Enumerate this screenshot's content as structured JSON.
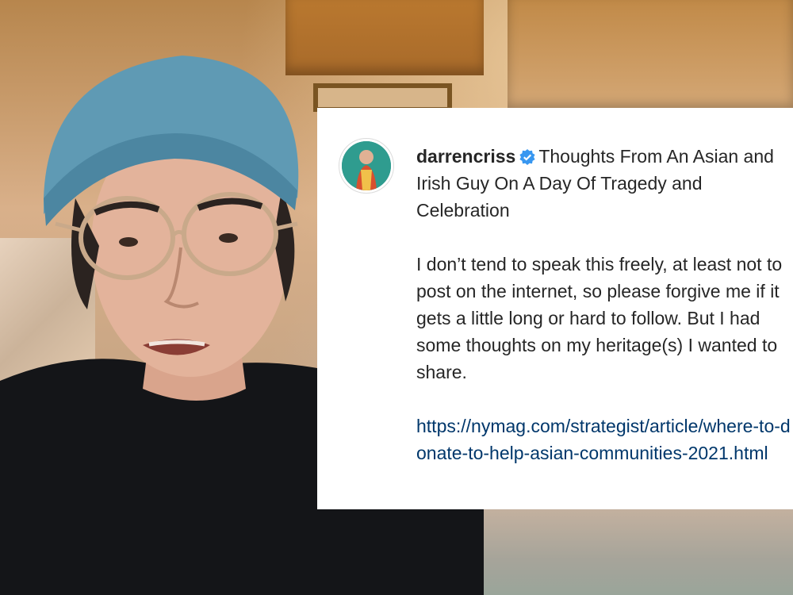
{
  "post": {
    "username": "darrencriss",
    "verified_icon": "verified-badge-icon",
    "title": "Thoughts From An Asian and Irish Guy On A Day Of Tragedy and Celebration",
    "body": "I don’t tend to speak this freely, at least not to post on the internet, so please forgive me if it gets a little long or hard to follow. But I had some thoughts on my heritage(s) I wanted to share.",
    "link": "https://nymag.com/strategist/article/where-to-donate-to-help-asian-communities-2021.html"
  },
  "colors": {
    "text": "#262626",
    "link": "#00376b",
    "verified": "#3897f0",
    "card": "#ffffff"
  }
}
